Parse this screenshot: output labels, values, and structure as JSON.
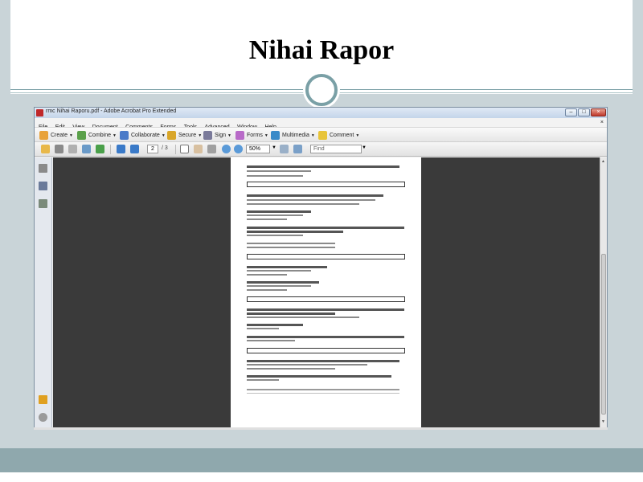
{
  "slide": {
    "title": "Nihai Rapor"
  },
  "window": {
    "title": "rmc Nihai Raporu.pdf - Adobe Acrobat Pro Extended",
    "min_label": "–",
    "max_label": "□",
    "close_label": "×"
  },
  "menubar": {
    "items": [
      "File",
      "Edit",
      "View",
      "Document",
      "Comments",
      "Forms",
      "Tools",
      "Advanced",
      "Window",
      "Help"
    ],
    "close_label": "×"
  },
  "toolbar": {
    "create": "Create",
    "combine": "Combine",
    "collaborate": "Collaborate",
    "secure": "Secure",
    "sign": "Sign",
    "forms": "Forms",
    "multimedia": "Multimedia",
    "comment": "Comment"
  },
  "nav": {
    "page_value": "2",
    "page_total": "/ 3",
    "zoom_value": "50%",
    "find_placeholder": "Find"
  },
  "icons": {
    "open": "folder-icon",
    "print": "printer-icon",
    "save": "save-icon",
    "email": "email-icon",
    "prev": "arrow-up-icon",
    "next": "arrow-down-icon",
    "select": "cursor-icon",
    "hand": "hand-icon",
    "zoom_in": "zoom-in-icon",
    "zoom_out": "zoom-out-icon"
  },
  "colors": {
    "frame": "#c9d4d8",
    "frame_bottom": "#8fa8ad",
    "accent": "#7aa0a6",
    "doc_background": "#3a3a3a"
  }
}
